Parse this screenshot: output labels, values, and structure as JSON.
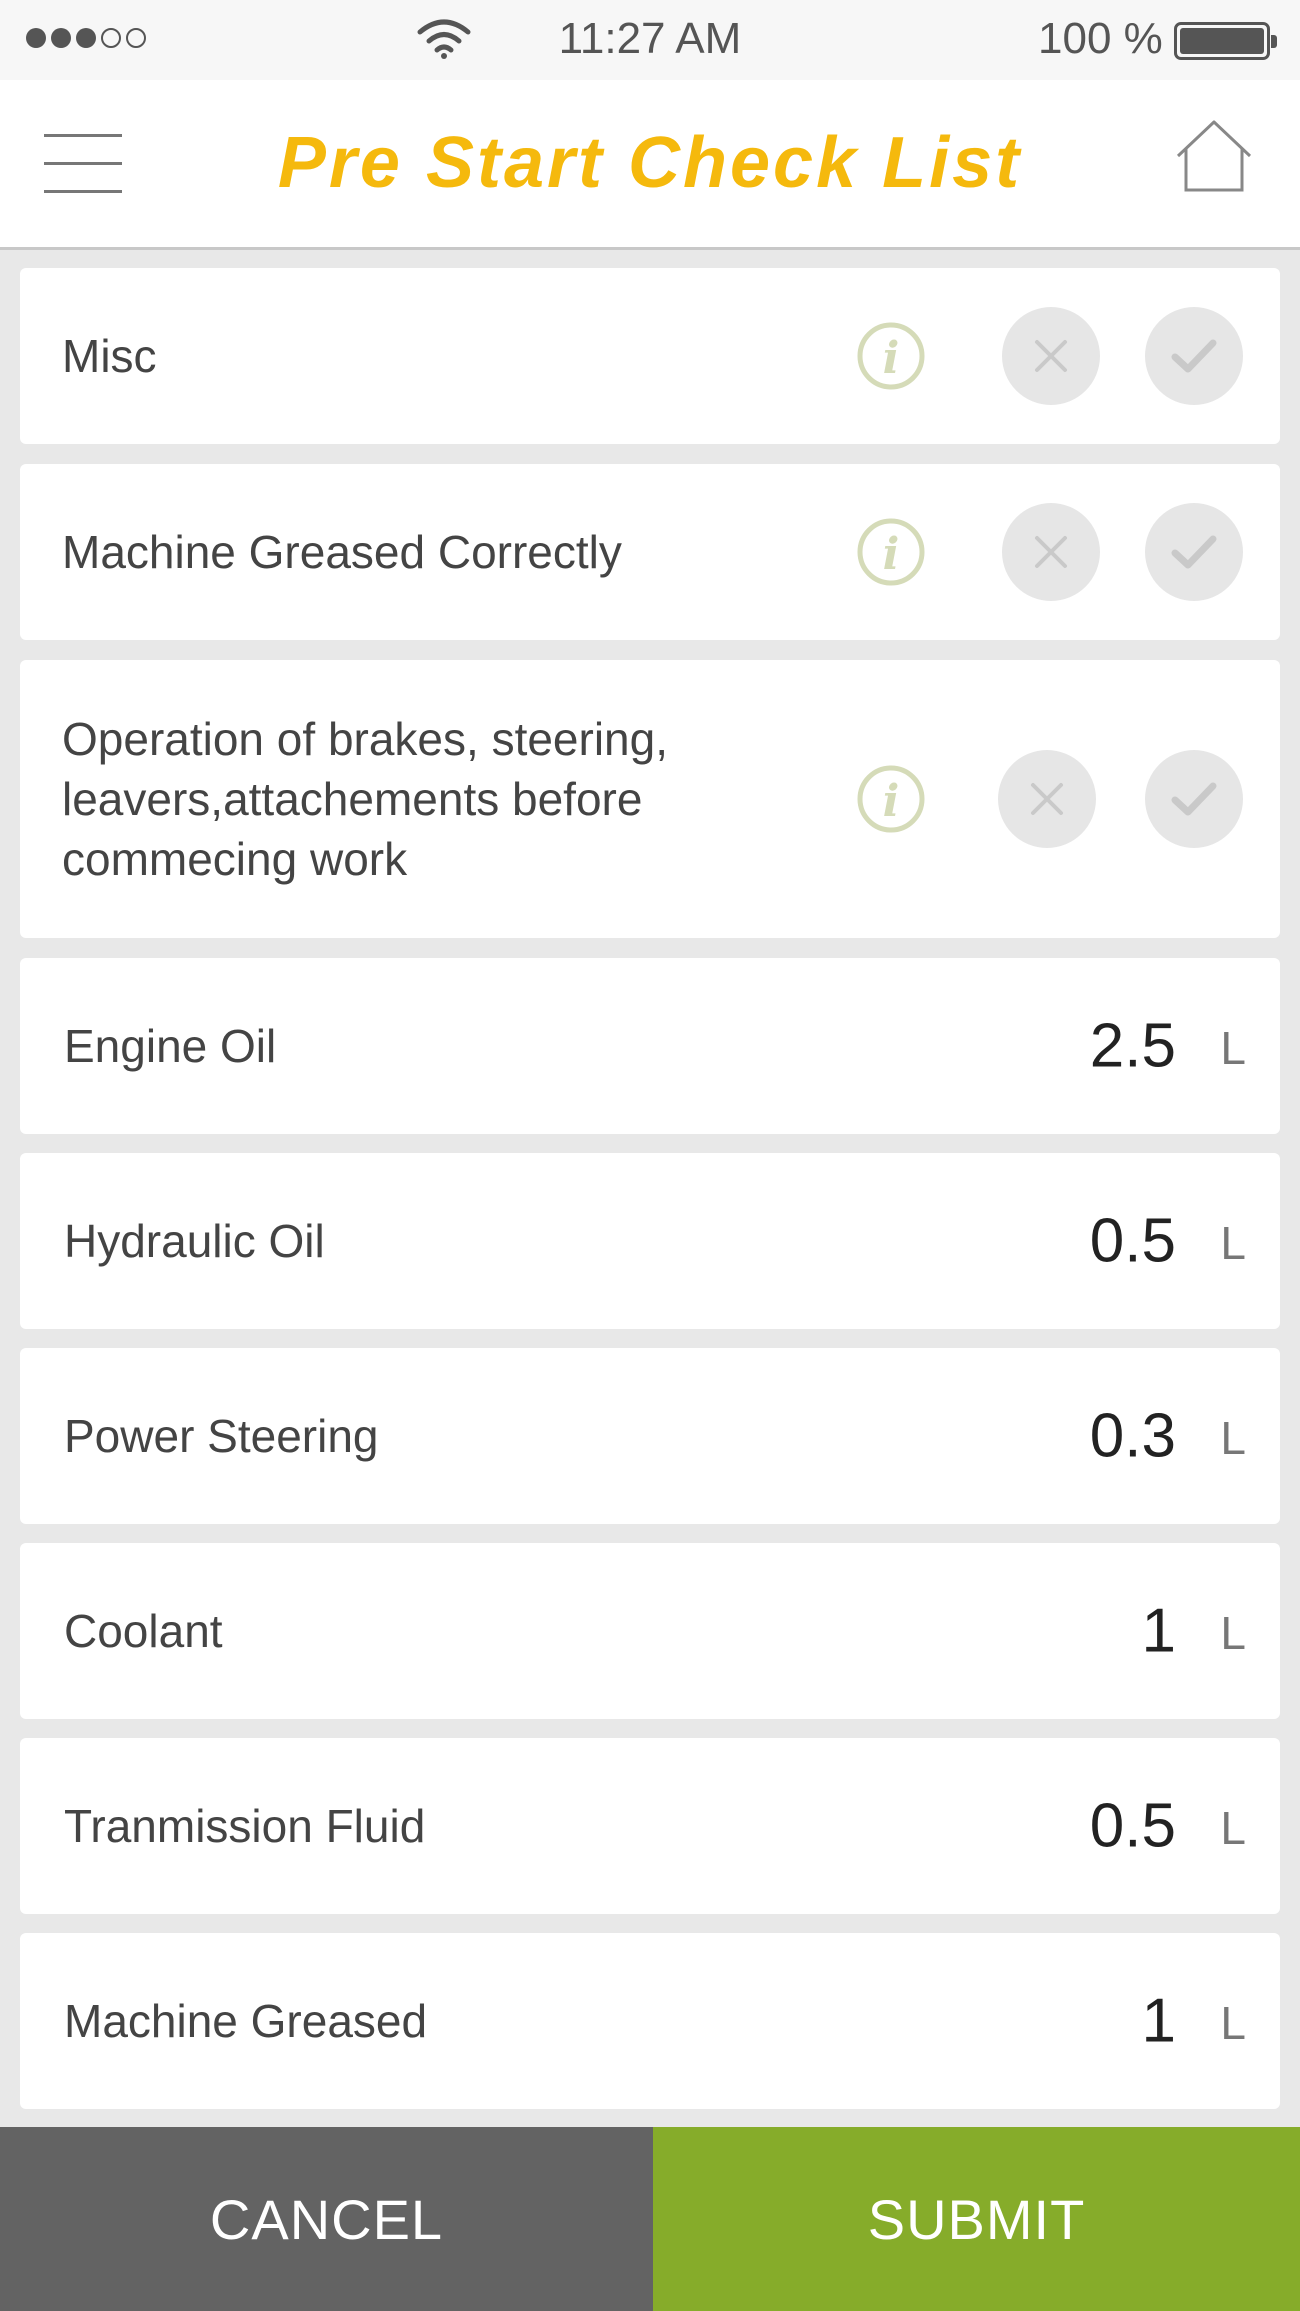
{
  "status_bar": {
    "time": "11:27 AM",
    "battery": "100 %",
    "signal_bars_filled": 3,
    "signal_bars_total": 5
  },
  "header": {
    "title": "Pre Start Check List",
    "title_color": "#f5b90d",
    "menu_icon": "hamburger-menu-icon",
    "home_icon": "home-icon"
  },
  "check_items": [
    {
      "label": "Misc"
    },
    {
      "label": "Machine Greased Correctly"
    },
    {
      "label": "Operation of brakes, steering, leavers,attachements before commecing work"
    }
  ],
  "value_items": [
    {
      "label": "Engine Oil",
      "value": "2.5",
      "unit": "L"
    },
    {
      "label": "Hydraulic Oil",
      "value": "0.5",
      "unit": "L"
    },
    {
      "label": "Power Steering",
      "value": "0.3",
      "unit": "L"
    },
    {
      "label": "Coolant",
      "value": "1",
      "unit": "L"
    },
    {
      "label": "Tranmission Fluid",
      "value": "0.5",
      "unit": "L"
    },
    {
      "label": "Machine Greased",
      "value": "1",
      "unit": "L"
    }
  ],
  "actions": {
    "cancel": "CANCEL",
    "submit": "SUBMIT",
    "cancel_color": "#636363",
    "submit_color": "#86ac2a"
  }
}
